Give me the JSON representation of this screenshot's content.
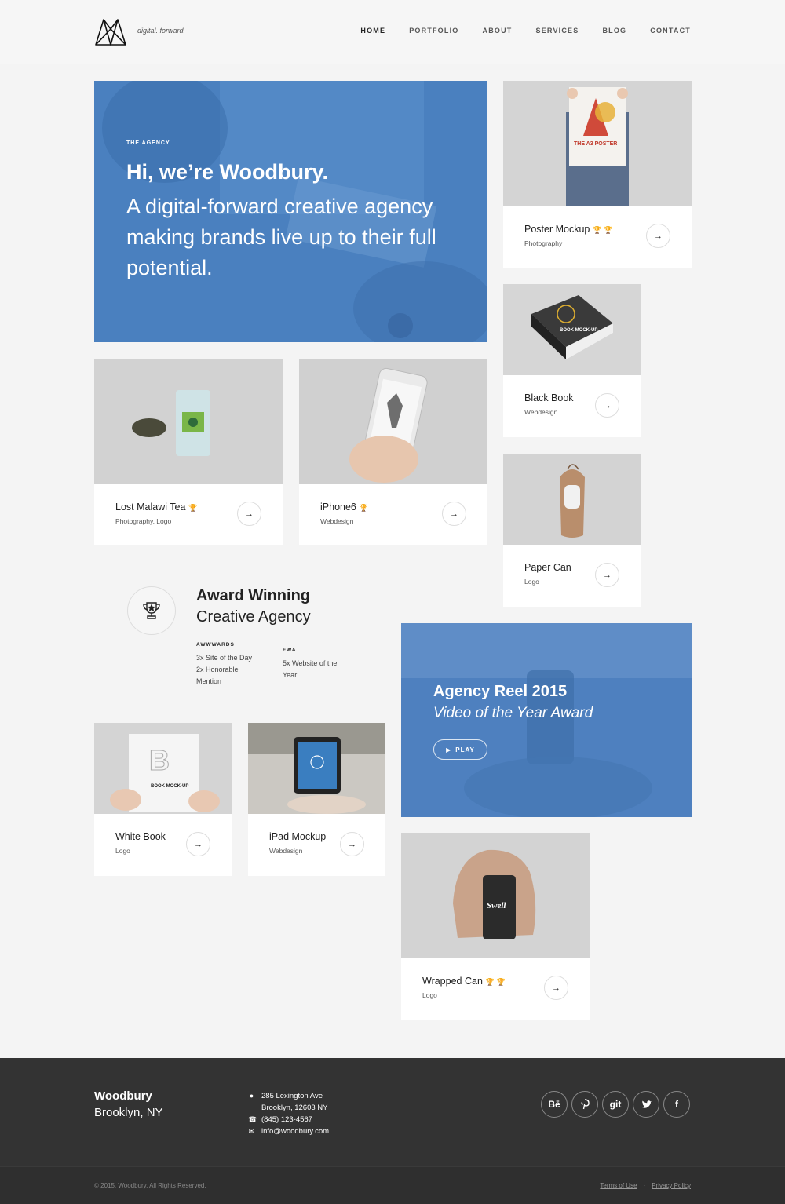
{
  "header": {
    "tagline": "digital. forward.",
    "nav": [
      "HOME",
      "PORTFOLIO",
      "ABOUT",
      "SERVICES",
      "BLOG",
      "CONTACT"
    ]
  },
  "hero": {
    "eyebrow": "THE AGENCY",
    "title": "Hi, we’re Woodbury.",
    "subtitle": "A digital-forward creative agency making brands live up to their full potential."
  },
  "projects": {
    "poster": {
      "title": "Poster Mockup",
      "category": "Photography",
      "trophies": "🏆 🏆",
      "poster_text": "THE A3 POSTER"
    },
    "black_book": {
      "title": "Black Book",
      "category": "Webdesign",
      "book_text": "BOOK MOCK-UP"
    },
    "tea": {
      "title": "Lost Malawi Tea",
      "category": "Photography, Logo",
      "trophies": "🏆"
    },
    "iphone": {
      "title": "iPhone6",
      "category": "Webdesign",
      "trophies": "🏆"
    },
    "paper_can": {
      "title": "Paper Can",
      "category": "Logo"
    },
    "white_book": {
      "title": "White Book",
      "category": "Logo",
      "book_text": "BOOK MOCK-UP"
    },
    "ipad": {
      "title": "iPad Mockup",
      "category": "Webdesign"
    },
    "wrapped_can": {
      "title": "Wrapped Can",
      "category": "Logo",
      "trophies": "🏆 🏆",
      "can_text": "Swell"
    }
  },
  "award": {
    "title": "Award Winning",
    "subtitle": "Creative Agency",
    "awwwards": {
      "heading": "AWWWARDS",
      "lines": [
        "3x Site of the Day",
        "2x Honorable",
        "Mention"
      ]
    },
    "fwa": {
      "heading": "FWA",
      "lines": [
        "5x Website of the",
        "Year"
      ]
    }
  },
  "reel": {
    "title": "Agency Reel 2015",
    "subtitle": "Video of the Year Award",
    "play": "PLAY"
  },
  "footer": {
    "brand": "Woodbury",
    "city": "Brooklyn, NY",
    "address1": "285 Lexington Ave",
    "address2": "Brooklyn, 12603 NY",
    "phone": "(845) 123-4567",
    "email": "info@woodbury.com",
    "social": [
      "Bē",
      "P",
      "git",
      "twitter",
      "f"
    ],
    "copyright": "© 2015, Woodbury. All Rights Reserved.",
    "terms": "Terms of Use",
    "privacy": "Privacy Policy"
  },
  "colors": {
    "accent_blue": "#4b82c0",
    "footer": "#333333"
  }
}
